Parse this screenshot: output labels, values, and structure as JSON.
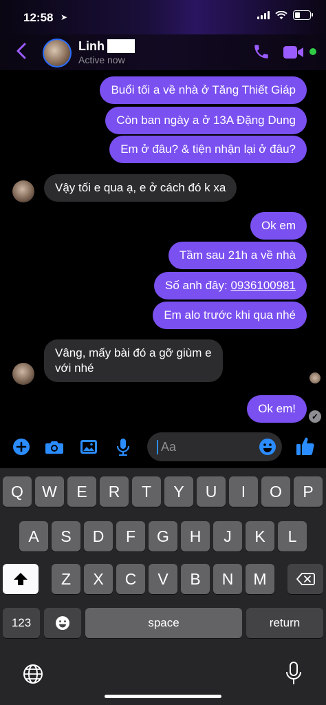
{
  "status": {
    "time": "12:58",
    "location_icon": "location-arrow-icon"
  },
  "header": {
    "name": "Linh",
    "active": "Active now",
    "avatar_icon": "contact-avatar"
  },
  "messages": [
    {
      "from": "me",
      "text": "Buổi tối a về nhà ở Tăng Thiết Giáp"
    },
    {
      "from": "me",
      "text": "Còn ban ngày a ở 13A Đặng Dung"
    },
    {
      "from": "me",
      "text": "Em ở đâu? & tiện nhận lại ở đâu?"
    },
    {
      "from": "them",
      "text": "Vậy tối e qua ạ, e ở cách đó k xa"
    },
    {
      "from": "me",
      "text": "Ok em"
    },
    {
      "from": "me",
      "text": "Tầm sau 21h a về nhà"
    },
    {
      "from": "me",
      "text_prefix": "Số anh đây: ",
      "link": "0936100981"
    },
    {
      "from": "me",
      "text": "Em alo trước khi qua nhé"
    },
    {
      "from": "them",
      "line1": "Vâng, mấy bài đó a gỡ giùm e",
      "line2": "với nhé"
    },
    {
      "from": "me",
      "text": "Ok em!"
    }
  ],
  "composer": {
    "placeholder": "Aa"
  },
  "keyboard": {
    "row1": [
      "Q",
      "W",
      "E",
      "R",
      "T",
      "Y",
      "U",
      "I",
      "O",
      "P"
    ],
    "row2": [
      "A",
      "S",
      "D",
      "F",
      "G",
      "H",
      "J",
      "K",
      "L"
    ],
    "row3": [
      "Z",
      "X",
      "C",
      "V",
      "B",
      "N",
      "M"
    ],
    "numbers_label": "123",
    "space_label": "space",
    "return_label": "return"
  },
  "colors": {
    "sent_bubble": "#7a50f0",
    "received_bubble": "#2c2c2e",
    "accent": "#2b8cff",
    "header_icons": "#9b5cff",
    "online": "#31cc46"
  }
}
